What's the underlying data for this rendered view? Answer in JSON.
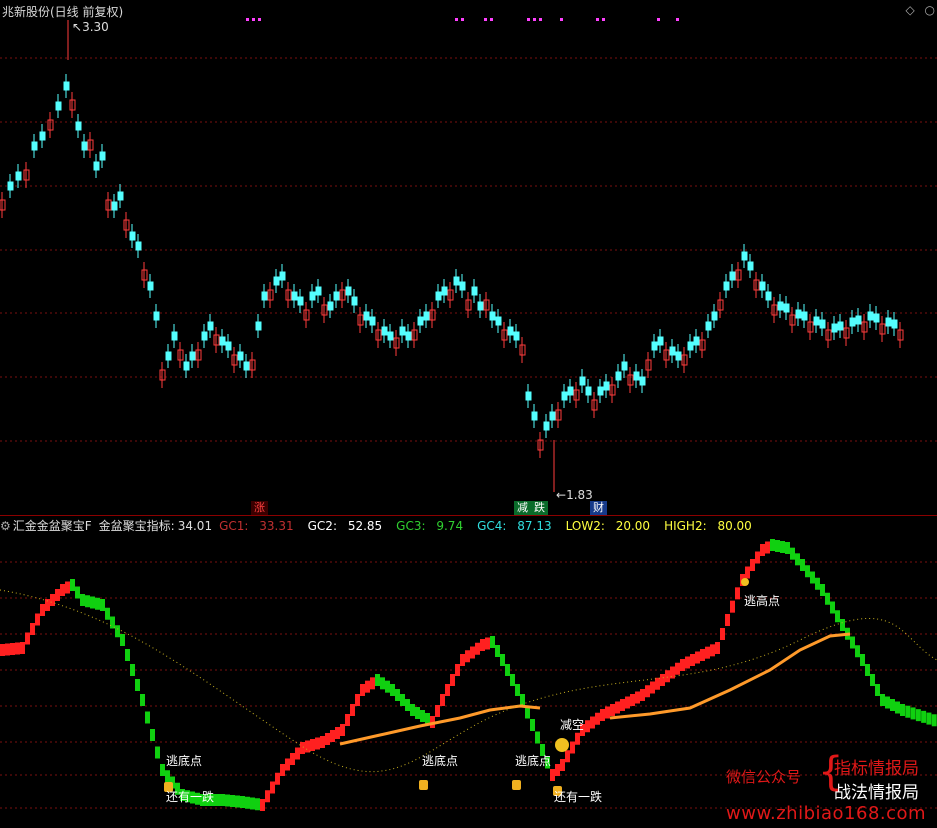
{
  "main_chart": {
    "title": "兆新股份(日线 前复权)",
    "controls": [
      "◇",
      "○"
    ],
    "high_label": "3.30",
    "low_label": "1.83",
    "markers": [
      {
        "text": "涨",
        "color": "#ff4040",
        "bg": "#3a0000"
      },
      {
        "text": "减",
        "color": "#ffffff",
        "bg": "#0a6b2a"
      },
      {
        "text": "跌",
        "color": "#ffffff",
        "bg": "#0a6b2a"
      },
      {
        "text": "财",
        "color": "#ffffff",
        "bg": "#173a8a"
      }
    ]
  },
  "indicator": {
    "name": "汇金金盆聚宝F",
    "label_prefix": "金盆聚宝指标:",
    "value": "34.01",
    "items": [
      {
        "label": "GC1:",
        "value": "33.31",
        "color": "#c03030"
      },
      {
        "label": "GC2:",
        "value": "52.85",
        "color": "#ffffff"
      },
      {
        "label": "GC3:",
        "value": "9.74",
        "color": "#30d030"
      },
      {
        "label": "GC4:",
        "value": "87.13",
        "color": "#30e0e0"
      },
      {
        "label": "LOW2:",
        "value": "20.00",
        "color": "#ffff40"
      },
      {
        "label": "HIGH2:",
        "value": "80.00",
        "color": "#ffff40"
      }
    ],
    "signals": {
      "escape_bottom": "逃底点",
      "escape_top": "逃高点",
      "reduce": "减空",
      "one_more_drop": "还有一跌"
    }
  },
  "watermark": {
    "wechat": "微信公众号",
    "line1": "指标情报局",
    "line2": "战法情报局",
    "url": "www.zhibiao168.com"
  },
  "colors": {
    "up": "#ff3c3c",
    "down": "#54ffff",
    "ind_up": "#ff2020",
    "ind_down": "#10d010",
    "ma_line": "#ff9a2a",
    "magenta": "#ff40ff"
  }
}
